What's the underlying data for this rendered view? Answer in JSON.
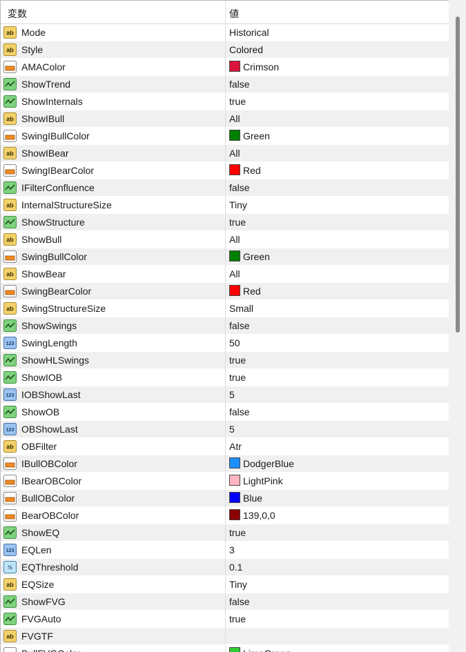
{
  "header": {
    "name": "変数",
    "value": "値"
  },
  "colors": {
    "Crimson": "#dc143c",
    "Green": "#008000",
    "Red": "#ff0000",
    "DodgerBlue": "#1e90ff",
    "LightPink": "#ffb6c1",
    "Blue": "#0000ff",
    "139,0,0": "#8b0000",
    "Lime": "#32cd32"
  },
  "rows": [
    {
      "type": "string",
      "name": "Mode",
      "value": "Historical"
    },
    {
      "type": "string",
      "name": "Style",
      "value": "Colored"
    },
    {
      "type": "color",
      "name": "AMAColor",
      "value": "Crimson",
      "swatch": "#dc143c"
    },
    {
      "type": "bool",
      "name": "ShowTrend",
      "value": "false"
    },
    {
      "type": "bool",
      "name": "ShowInternals",
      "value": "true"
    },
    {
      "type": "string",
      "name": "ShowIBull",
      "value": "All"
    },
    {
      "type": "color",
      "name": "SwingIBullColor",
      "value": "Green",
      "swatch": "#008000"
    },
    {
      "type": "string",
      "name": "ShowIBear",
      "value": "All"
    },
    {
      "type": "color",
      "name": "SwingIBearColor",
      "value": "Red",
      "swatch": "#ff0000"
    },
    {
      "type": "bool",
      "name": "IFilterConfluence",
      "value": "false"
    },
    {
      "type": "string",
      "name": "InternalStructureSize",
      "value": "Tiny"
    },
    {
      "type": "bool",
      "name": "ShowStructure",
      "value": "true"
    },
    {
      "type": "string",
      "name": "ShowBull",
      "value": "All"
    },
    {
      "type": "color",
      "name": "SwingBullColor",
      "value": "Green",
      "swatch": "#008000"
    },
    {
      "type": "string",
      "name": "ShowBear",
      "value": "All"
    },
    {
      "type": "color",
      "name": "SwingBearColor",
      "value": "Red",
      "swatch": "#ff0000"
    },
    {
      "type": "string",
      "name": "SwingStructureSize",
      "value": "Small"
    },
    {
      "type": "bool",
      "name": "ShowSwings",
      "value": "false"
    },
    {
      "type": "int",
      "name": "SwingLength",
      "value": "50"
    },
    {
      "type": "bool",
      "name": "ShowHLSwings",
      "value": "true"
    },
    {
      "type": "bool",
      "name": "ShowIOB",
      "value": "true"
    },
    {
      "type": "int",
      "name": "IOBShowLast",
      "value": "5"
    },
    {
      "type": "bool",
      "name": "ShowOB",
      "value": "false"
    },
    {
      "type": "int",
      "name": "OBShowLast",
      "value": "5"
    },
    {
      "type": "string",
      "name": "OBFilter",
      "value": "Atr"
    },
    {
      "type": "color",
      "name": "IBullOBColor",
      "value": "DodgerBlue",
      "swatch": "#1e90ff"
    },
    {
      "type": "color",
      "name": "IBearOBColor",
      "value": "LightPink",
      "swatch": "#ffb6c1"
    },
    {
      "type": "color",
      "name": "BullOBColor",
      "value": "Blue",
      "swatch": "#0000ff"
    },
    {
      "type": "color",
      "name": "BearOBColor",
      "value": "139,0,0",
      "swatch": "#8b0000"
    },
    {
      "type": "bool",
      "name": "ShowEQ",
      "value": "true"
    },
    {
      "type": "int",
      "name": "EQLen",
      "value": "3"
    },
    {
      "type": "double",
      "name": "EQThreshold",
      "value": "0.1"
    },
    {
      "type": "string",
      "name": "EQSize",
      "value": "Tiny"
    },
    {
      "type": "bool",
      "name": "ShowFVG",
      "value": "false"
    },
    {
      "type": "bool",
      "name": "FVGAuto",
      "value": "true"
    },
    {
      "type": "string",
      "name": "FVGTF",
      "value": ""
    },
    {
      "type": "color",
      "name": "BullFVGColor",
      "value": "LimeGreen",
      "swatch": "#32cd32"
    }
  ]
}
